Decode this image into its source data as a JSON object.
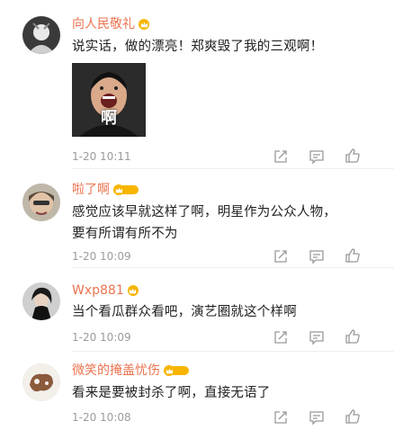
{
  "comments": [
    {
      "name": "向人民敬礼",
      "vip_level": "",
      "text": "说实话，做的漂亮！郑爽毁了我的三观啊！",
      "image_caption": "啊",
      "time": "1-20 10:11"
    },
    {
      "name": "啦了啊",
      "vip_level": "",
      "text_line1": "感觉应该早就这样了啊，明星作为公众人物，",
      "text_line2": "要有所谓有所不为",
      "time": "1-20 10:09"
    },
    {
      "name": "Wxp881",
      "vip_level": "",
      "text": "当个看瓜群众看吧，演艺圈就这个样啊",
      "time": "1-20 10:09"
    },
    {
      "name": "微笑的掩盖忧伤",
      "vip_level": "",
      "text": "看来是要被封杀了啊，直接无语了",
      "time": "1-20 10:08"
    }
  ],
  "icons": {
    "share": "share-icon",
    "comment": "comment-icon",
    "like": "like-icon"
  },
  "colors": {
    "username": "#eb7350",
    "vip": "#f7b500",
    "meta": "#9b9b9b"
  }
}
